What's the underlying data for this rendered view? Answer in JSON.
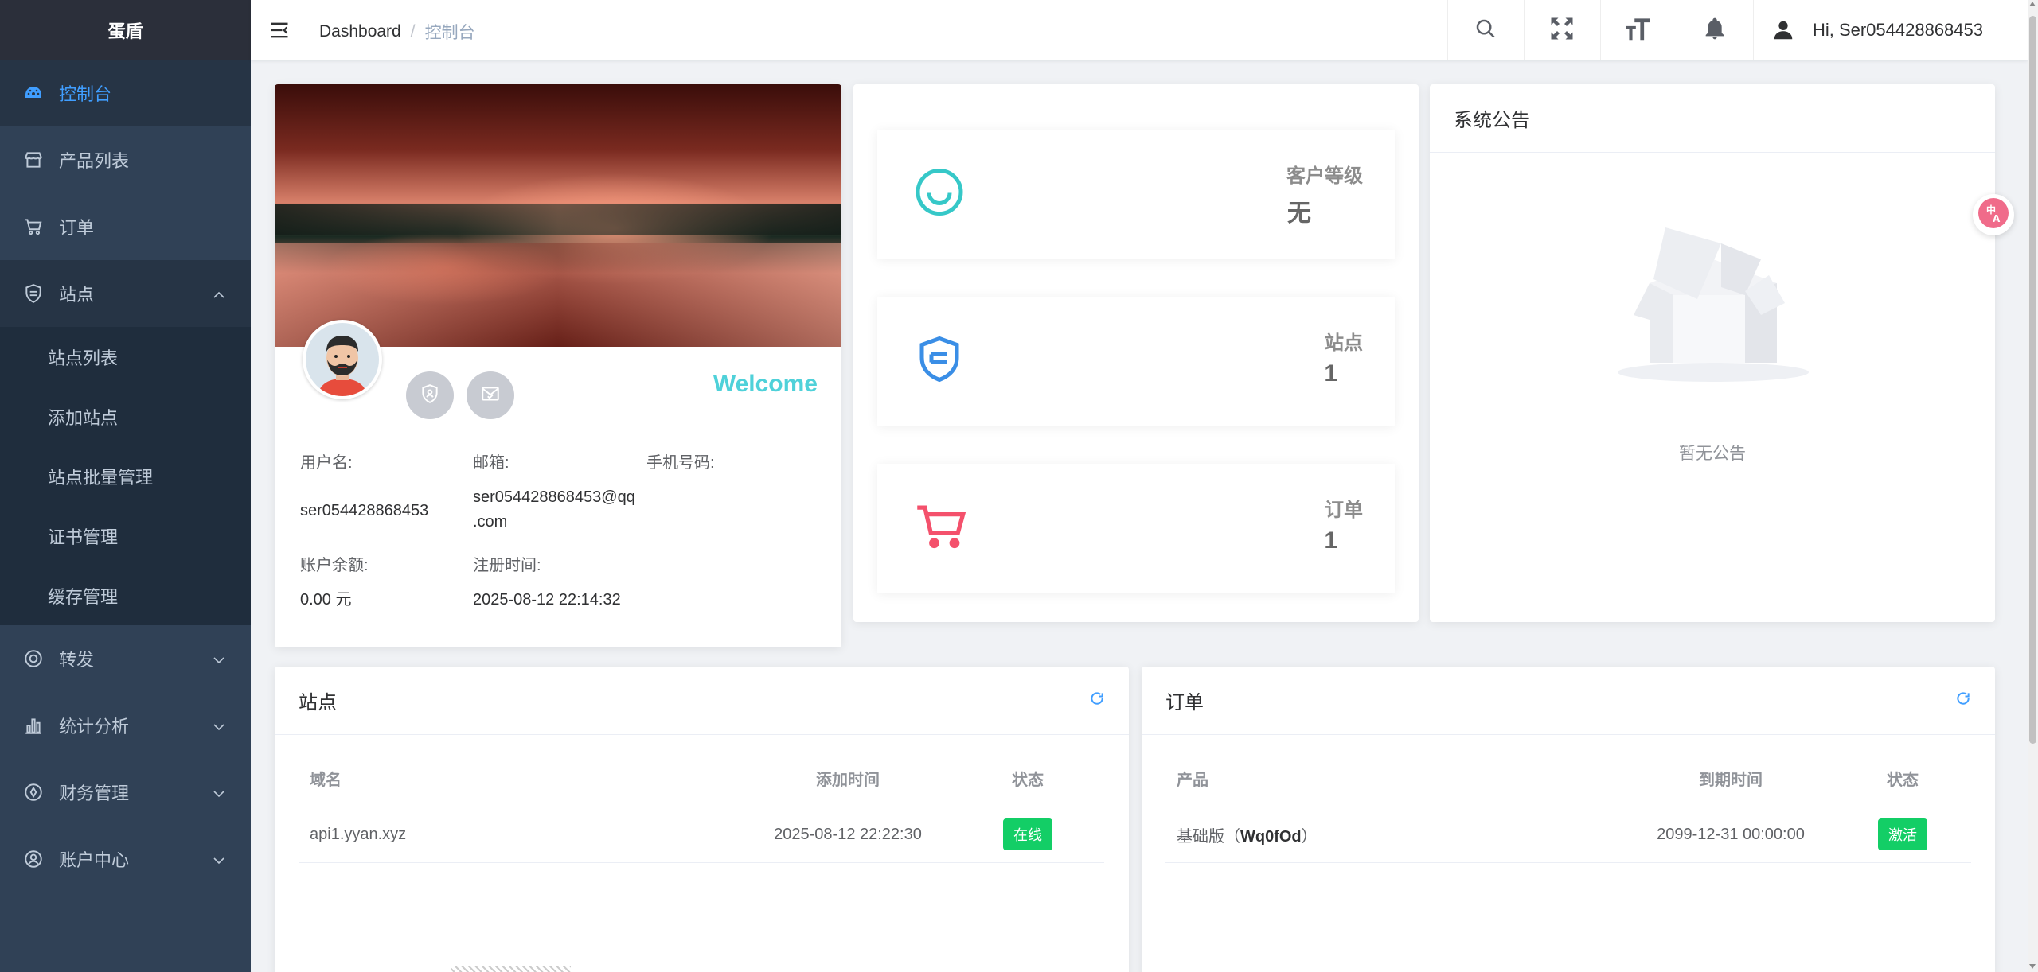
{
  "brand": "蛋盾",
  "sidebar": {
    "items": [
      {
        "label": "控制台"
      },
      {
        "label": "产品列表"
      },
      {
        "label": "订单"
      },
      {
        "label": "站点"
      },
      {
        "label": "转发"
      },
      {
        "label": "统计分析"
      },
      {
        "label": "财务管理"
      },
      {
        "label": "账户中心"
      }
    ],
    "submenu": [
      "站点列表",
      "添加站点",
      "站点批量管理",
      "证书管理",
      "缓存管理"
    ]
  },
  "header": {
    "breadcrumb_home": "Dashboard",
    "breadcrumb_sep": "/",
    "breadcrumb_current": "控制台",
    "greeting": "Hi, Ser054428868453"
  },
  "profile": {
    "welcome": "Welcome",
    "labels": {
      "username": "用户名:",
      "email": "邮箱:",
      "phone": "手机号码:",
      "balance": "账户余额:",
      "registered": "注册时间:"
    },
    "username": "ser054428868453",
    "email_line1": "ser054428868453@qq",
    "email_line2": ".com",
    "phone": "",
    "balance": "0.00 元",
    "registered": "2025-08-12 22:14:32"
  },
  "stats": [
    {
      "title": "客户等级",
      "value": "无",
      "color": "#36c8c8"
    },
    {
      "title": "站点",
      "value": "1",
      "color": "#3a8ee6"
    },
    {
      "title": "订单",
      "value": "1",
      "color": "#f4516c"
    }
  ],
  "notice": {
    "title": "系统公告",
    "empty": "暂无公告"
  },
  "sites_table": {
    "title": "站点",
    "columns": [
      "域名",
      "添加时间",
      "状态"
    ],
    "rows": [
      {
        "domain": "api1.yyan.xyz",
        "added": "2025-08-12 22:22:30",
        "status": "在线"
      }
    ]
  },
  "orders_table": {
    "title": "订单",
    "columns": [
      "产品",
      "到期时间",
      "状态"
    ],
    "rows": [
      {
        "product_prefix": "基础版（",
        "product_code": "Wq0fOd",
        "product_suffix": "）",
        "expires": "2099-12-31 00:00:00",
        "status": "激活"
      }
    ]
  }
}
